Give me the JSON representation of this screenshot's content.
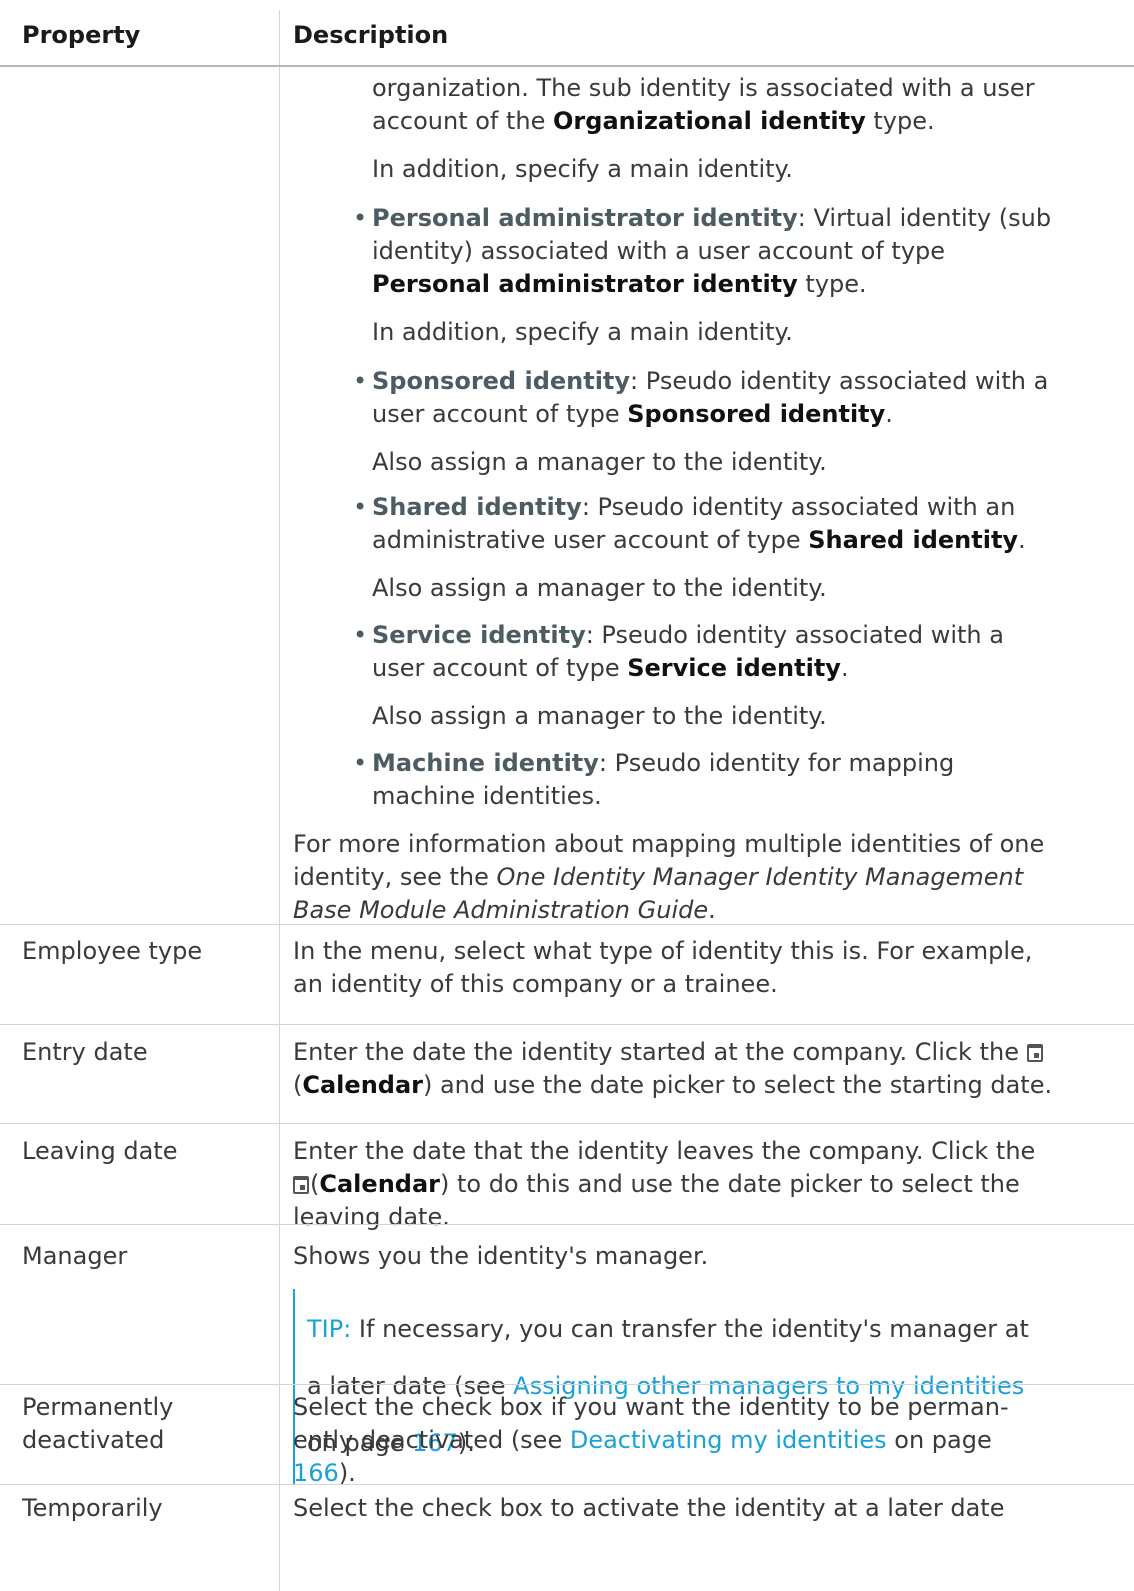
{
  "header": {
    "col_property": "Property",
    "col_description": "Description"
  },
  "row1": {
    "cont_line1": "organization. The sub identity is associated with a user",
    "cont_line2_a": "account of the ",
    "cont_line2_b": "Organizational identity",
    "cont_line2_c": " type.",
    "note1": "In addition, specify a main identity.",
    "b1_term": "Personal administrator identity",
    "b1_line1_rest": ": Virtual identity (sub",
    "b1_line2": "identity) associated with a user account of type",
    "b1_line3_bold": "Personal administrator identity",
    "b1_line3_rest": " type.",
    "note2": "In addition, specify a main identity.",
    "b2_term": "Sponsored identity",
    "b2_line1_rest": ": Pseudo identity associated with a",
    "b2_line2_a": "user account of type ",
    "b2_line2_bold": "Sponsored identity",
    "b2_line2_c": ".",
    "note3": "Also assign a manager to the identity.",
    "b3_term": "Shared identity",
    "b3_line1_rest": ": Pseudo identity associated with an",
    "b3_line2_a": "administrative user account of type ",
    "b3_line2_bold": "Shared identity",
    "b3_line2_c": ".",
    "note4": "Also assign a manager to the identity.",
    "b4_term": "Service identity",
    "b4_line1_rest": ": Pseudo identity associated with a",
    "b4_line2_a": "user account of type ",
    "b4_line2_bold": "Service identity",
    "b4_line2_c": ".",
    "note5": "Also assign a manager to the identity.",
    "b5_term": "Machine identity",
    "b5_line1_rest": ": Pseudo identity for mapping",
    "b5_line2": "machine identities.",
    "more_line1": "For more information about mapping multiple identities of one",
    "more_line2_a": "identity, see the ",
    "more_line2_i": "One Identity Manager Identity Management",
    "more_line3_i": "Base Module Administration Guide",
    "more_line3_c": "."
  },
  "employee_type": {
    "property": "Employee type",
    "line1": "In the menu, select what type of identity this is. For example,",
    "line2": "an identity of this company or a trainee."
  },
  "entry_date": {
    "property": "Entry date",
    "line1": "Enter the date the identity started at the company. Click the ",
    "line2_open": "(",
    "line2_bold": "Calendar",
    "line2_rest": ") and use the date picker to select the starting date.",
    "icon": "calendar-icon"
  },
  "leaving_date": {
    "property": "Leaving date",
    "line1": "Enter the date that the identity leaves the company. Click the",
    "line2_open": "(",
    "line2_bold": "Calendar",
    "line2_rest": ") to do this and use the date picker to select the",
    "line3": "leaving date.",
    "icon": "calendar-icon"
  },
  "manager": {
    "property": "Manager",
    "line1": "Shows you the identity's manager.",
    "tip_label": "TIP:",
    "tip_line1_rest": " If necessary, you can transfer the identity's manager at",
    "tip_line2_a": "a later date (see ",
    "tip_line2_link": "Assigning other managers to my identities",
    "tip_line3_a": "on page ",
    "tip_line3_page": "167",
    "tip_line3_c": ")."
  },
  "permanently_deactivated": {
    "property_line1": "Permanently",
    "property_line2": "deactivated",
    "line1": "Select the check box if you want the identity to be perman-",
    "line2_a": "ently deactivated (see ",
    "line2_link": "Deactivating my identities",
    "line2_c": " on page",
    "line3_page": "166",
    "line3_c": ")."
  },
  "temporarily": {
    "property": "Temporarily",
    "line1": "Select the check box to activate the identity at a later date"
  }
}
